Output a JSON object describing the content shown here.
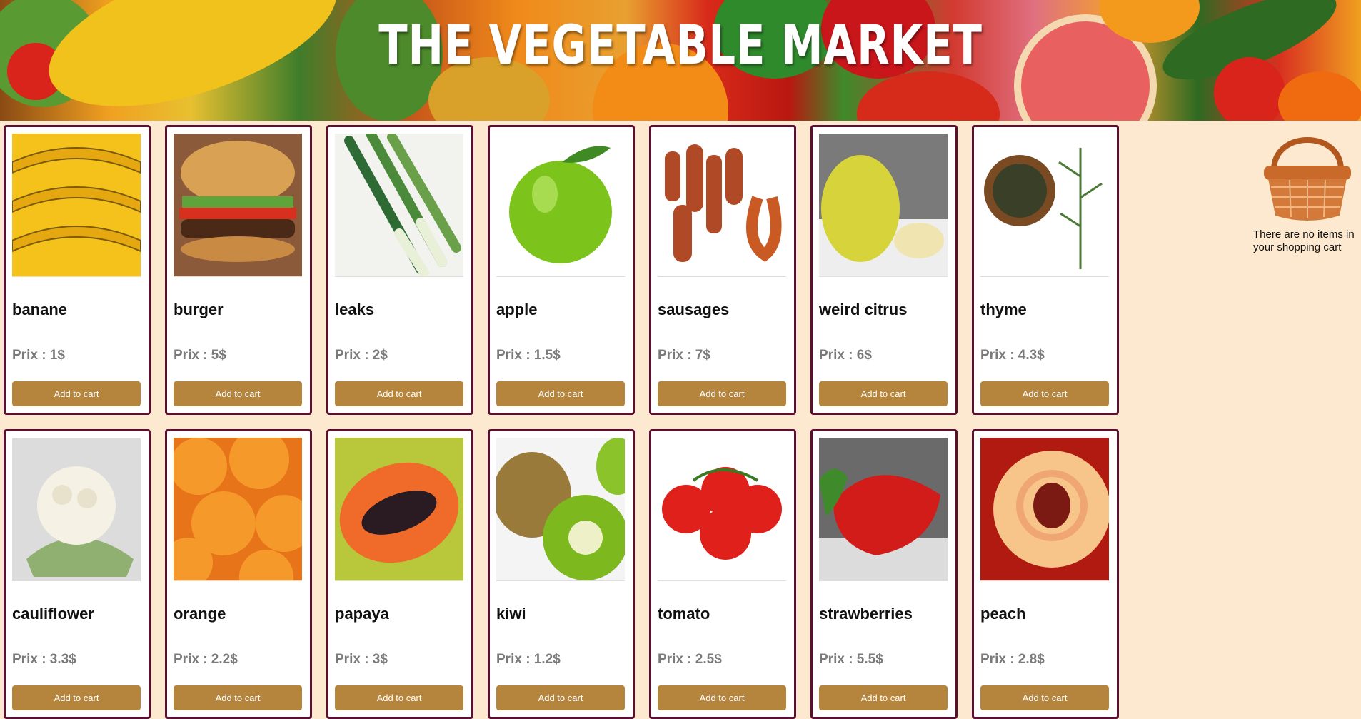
{
  "header": {
    "title": "THE VEGETABLE MARKET"
  },
  "products": [
    {
      "name": "banane",
      "price_label": "Prix : 1$",
      "button": "Add to cart",
      "image": "banana-image"
    },
    {
      "name": "burger",
      "price_label": "Prix : 5$",
      "button": "Add to cart",
      "image": "burger-image"
    },
    {
      "name": "leaks",
      "price_label": "Prix : 2$",
      "button": "Add to cart",
      "image": "leek-image"
    },
    {
      "name": "apple",
      "price_label": "Prix : 1.5$",
      "button": "Add to cart",
      "image": "apple-image"
    },
    {
      "name": "sausages",
      "price_label": "Prix : 7$",
      "button": "Add to cart",
      "image": "sausage-image"
    },
    {
      "name": "weird citrus",
      "price_label": "Prix : 6$",
      "button": "Add to cart",
      "image": "citrus-image"
    },
    {
      "name": "thyme",
      "price_label": "Prix : 4.3$",
      "button": "Add to cart",
      "image": "thyme-image"
    },
    {
      "name": "cauliflower",
      "price_label": "Prix : 3.3$",
      "button": "Add to cart",
      "image": "cauliflower-image"
    },
    {
      "name": "orange",
      "price_label": "Prix : 2.2$",
      "button": "Add to cart",
      "image": "orange-image"
    },
    {
      "name": "papaya",
      "price_label": "Prix : 3$",
      "button": "Add to cart",
      "image": "papaya-image"
    },
    {
      "name": "kiwi",
      "price_label": "Prix : 1.2$",
      "button": "Add to cart",
      "image": "kiwi-image"
    },
    {
      "name": "tomato",
      "price_label": "Prix : 2.5$",
      "button": "Add to cart",
      "image": "tomato-image"
    },
    {
      "name": "strawberries",
      "price_label": "Prix : 5.5$",
      "button": "Add to cart",
      "image": "strawberry-image"
    },
    {
      "name": "peach",
      "price_label": "Prix : 2.8$",
      "button": "Add to cart",
      "image": "peach-image"
    }
  ],
  "cart": {
    "icon": "basket-icon",
    "empty_message": "There are no items in your shopping cart"
  },
  "colors": {
    "background": "#fde9cf",
    "card_border": "#5a0f33",
    "button": "#b5853d",
    "price_text": "#7a7a7a"
  }
}
